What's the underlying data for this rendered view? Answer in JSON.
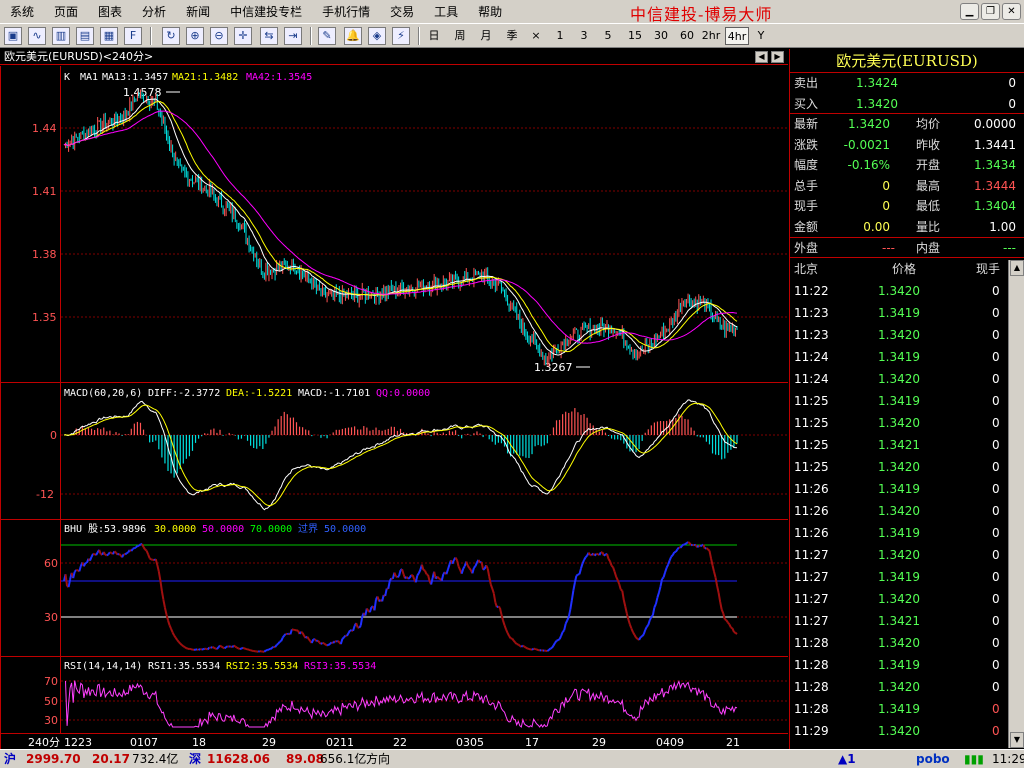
{
  "menu": {
    "items": [
      "系统",
      "页面",
      "图表",
      "分析",
      "新闻",
      "中信建投专栏",
      "手机行情",
      "交易",
      "工具",
      "帮助"
    ],
    "brand": "中信建投-博易大师"
  },
  "toolbar": {
    "periods": [
      "日",
      "周",
      "月",
      "季",
      "×",
      "1",
      "3",
      "5",
      "15",
      "30",
      "60",
      "2hr",
      "4hr",
      "Y"
    ],
    "active_period": "4hr"
  },
  "chart": {
    "title": "欧元美元(EURUSD)<240分>",
    "period_label": "240分",
    "kline_legend": {
      "k": "K",
      "ma1": "MA1",
      "ma13": "MA13:1.3457",
      "ma21": "MA21:1.3482",
      "ma42": "MA42:1.3545"
    },
    "kline_axis": [
      "1.44",
      "1.41",
      "1.38",
      "1.35"
    ],
    "kline_annotations": {
      "high": "1.4578",
      "low": "1.3267"
    },
    "macd_legend": {
      "name": "MACD(60,20,6)",
      "diff": "DIFF:-2.3772",
      "dea": "DEA:-1.5221",
      "macd": "MACD:-1.7101",
      "qq": "QQ:0.0000"
    },
    "macd_axis": [
      "0",
      "-12"
    ],
    "bhu_legend": {
      "name": "BHU",
      "gu": "股:53.9896",
      "l30": "30.0000",
      "l50": "50.0000",
      "l70": "70.0000",
      "guojie": "过界 50.0000"
    },
    "bhu_axis": [
      "60",
      "30"
    ],
    "rsi_legend": {
      "name": "RSI(14,14,14)",
      "rsi1": "RSI1:35.5534",
      "rsi2": "RSI2:35.5534",
      "rsi3": "RSI3:35.5534"
    },
    "rsi_axis": [
      "70",
      "50",
      "30"
    ],
    "x_labels": [
      "1223",
      "0107",
      "18",
      "29",
      "0211",
      "22",
      "0305",
      "17",
      "29",
      "0409",
      "21"
    ]
  },
  "quote": {
    "title": "欧元美元(EURUSD)",
    "sell": {
      "label": "卖出",
      "price": "1.3424",
      "vol": "0"
    },
    "buy": {
      "label": "买入",
      "price": "1.3420",
      "vol": "0"
    },
    "stats": [
      {
        "l1": "最新",
        "v1": "1.3420",
        "l2": "均价",
        "v2": "0.0000"
      },
      {
        "l1": "涨跌",
        "v1": "-0.0021",
        "l2": "昨收",
        "v2": "1.3441"
      },
      {
        "l1": "幅度",
        "v1": "-0.16%",
        "l2": "开盘",
        "v2": "1.3434"
      },
      {
        "l1": "总手",
        "v1": "0",
        "l2": "最高",
        "v2": "1.3444"
      },
      {
        "l1": "现手",
        "v1": "0",
        "l2": "最低",
        "v2": "1.3404"
      },
      {
        "l1": "金额",
        "v1": "0.00",
        "l2": "量比",
        "v2": "1.00"
      }
    ],
    "outer": {
      "label": "外盘",
      "value": "---"
    },
    "inner": {
      "label": "内盘",
      "value": "---"
    },
    "ticks_header": {
      "time": "北京",
      "price": "价格",
      "qty": "现手"
    },
    "ticks": [
      {
        "time": "11:22",
        "price": "1.3420",
        "qty": "0"
      },
      {
        "time": "11:23",
        "price": "1.3419",
        "qty": "0"
      },
      {
        "time": "11:23",
        "price": "1.3420",
        "qty": "0"
      },
      {
        "time": "11:24",
        "price": "1.3419",
        "qty": "0"
      },
      {
        "time": "11:24",
        "price": "1.3420",
        "qty": "0"
      },
      {
        "time": "11:25",
        "price": "1.3419",
        "qty": "0"
      },
      {
        "time": "11:25",
        "price": "1.3420",
        "qty": "0"
      },
      {
        "time": "11:25",
        "price": "1.3421",
        "qty": "0"
      },
      {
        "time": "11:25",
        "price": "1.3420",
        "qty": "0"
      },
      {
        "time": "11:26",
        "price": "1.3419",
        "qty": "0"
      },
      {
        "time": "11:26",
        "price": "1.3420",
        "qty": "0"
      },
      {
        "time": "11:26",
        "price": "1.3419",
        "qty": "0"
      },
      {
        "time": "11:27",
        "price": "1.3420",
        "qty": "0"
      },
      {
        "time": "11:27",
        "price": "1.3419",
        "qty": "0"
      },
      {
        "time": "11:27",
        "price": "1.3420",
        "qty": "0"
      },
      {
        "time": "11:27",
        "price": "1.3421",
        "qty": "0"
      },
      {
        "time": "11:28",
        "price": "1.3420",
        "qty": "0"
      },
      {
        "time": "11:28",
        "price": "1.3419",
        "qty": "0"
      },
      {
        "time": "11:28",
        "price": "1.3420",
        "qty": "0"
      },
      {
        "time": "11:28",
        "price": "1.3419",
        "qty": "0"
      },
      {
        "time": "11:29",
        "price": "1.3420",
        "qty": "0"
      }
    ]
  },
  "status": {
    "sh_label": "沪",
    "sh_index": "2999.70",
    "sh_change": "20.17",
    "sh_amount": "732.4亿",
    "sz_label": "深",
    "sz_index": "11628.06",
    "sz_change": "89.08",
    "sz_amount": "656.1亿",
    "direction": "方向",
    "alert": "▲1",
    "logo": "pobo",
    "time": "11:29"
  },
  "colors": {
    "up": "#ff5454",
    "down": "#00e0e0",
    "ma13": "#ffffff",
    "ma21": "#ffff00",
    "ma42": "#ff00ff",
    "grid": "#800000",
    "quote_green": "#54ff54",
    "quote_red": "#ff5454"
  }
}
